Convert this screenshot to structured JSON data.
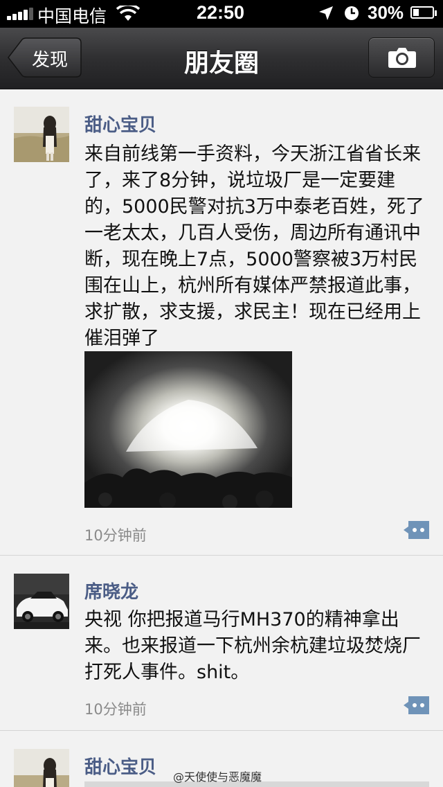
{
  "status_bar": {
    "carrier": "中国电信",
    "time": "22:50",
    "battery": "30%",
    "battery_level": 0.3
  },
  "nav": {
    "back_label": "发现",
    "title": "朋友圈",
    "camera_icon": "camera-icon"
  },
  "posts": [
    {
      "user": "甜心宝贝",
      "text": "来自前线第一手资料，今天浙江省省长来了，来了8分钟，说垃圾厂是一定要建的，5000民警对抗3万中泰老百姓，死了一老太太，几百人受伤，周边所有通讯中断，现在晚上7点，5000警察被3万村民围在山上，杭州所有媒体严禁报道此事，求扩散，求支援，求民主！现在已经用上催泪弹了",
      "time": "10分钟前"
    },
    {
      "user": "席晓龙",
      "text": "央视 你把报道马行MH370的精神拿出来。也来报道一下杭州余杭建垃圾焚烧厂打死人事件。shit。",
      "time": "10分钟前"
    },
    {
      "user": "甜心宝贝"
    }
  ],
  "watermark": "@天使使与恶魔魔",
  "colors": {
    "username": "#4b5d86",
    "comment_button": "#6f93b8"
  }
}
